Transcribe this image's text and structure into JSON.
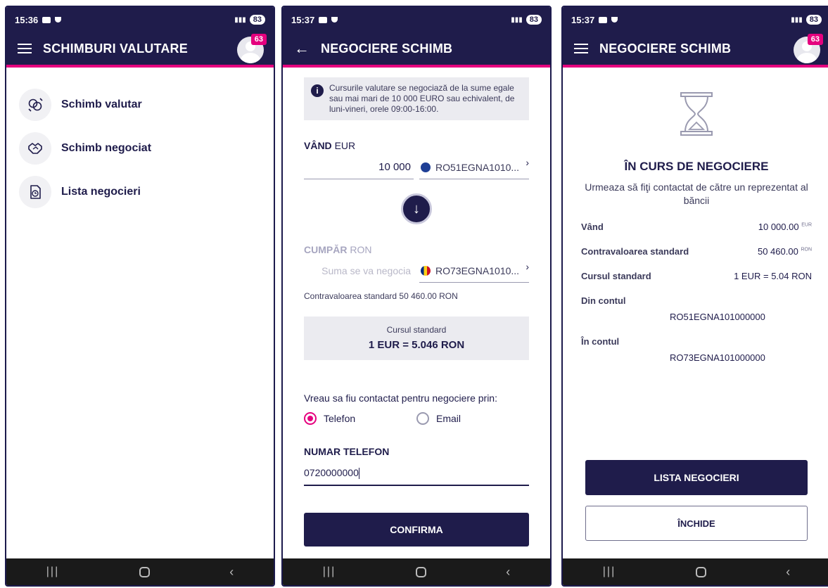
{
  "colors": {
    "primary": "#1f1c4b",
    "accent": "#e5007e",
    "panel": "#ebebf0"
  },
  "screen1": {
    "status": {
      "time": "15:36",
      "battery": "83"
    },
    "title": "SCHIMBURI VALUTARE",
    "badge": "63",
    "menu": [
      {
        "label": "Schimb valutar",
        "icon": "currency-exchange-icon"
      },
      {
        "label": "Schimb negociat",
        "icon": "handshake-icon"
      },
      {
        "label": "Lista negocieri",
        "icon": "clock-document-icon"
      }
    ]
  },
  "screen2": {
    "status": {
      "time": "15:37",
      "battery": "83"
    },
    "title": "NEGOCIERE SCHIMB",
    "info": "Cursurile valutare se negociază de la sume egale sau mai mari de 10 000 EURO sau echivalent, de luni-vineri, orele 09:00-16:00.",
    "sell": {
      "label": "VÂND",
      "currency": "EUR",
      "amount": "10 000",
      "account": "RO51EGNA1010..."
    },
    "buy": {
      "label": "CUMPĂR",
      "currency": "RON",
      "placeholder": "Suma se va negocia",
      "account": "RO73EGNA1010..."
    },
    "standard_note": "Contravaloarea standard 50 460.00 RON",
    "rate": {
      "caption": "Cursul standard",
      "value": "1 EUR = 5.046 RON"
    },
    "contact_question": "Vreau sa fiu contactat pentru negociere prin:",
    "options": {
      "phone": "Telefon",
      "email": "Email",
      "selected": "phone"
    },
    "phone_label": "NUMAR TELEFON",
    "phone_value": "0720000000",
    "confirm": "CONFIRMA"
  },
  "screen3": {
    "status": {
      "time": "15:37",
      "battery": "83"
    },
    "title": "NEGOCIERE SCHIMB",
    "badge": "63",
    "status_title": "ÎN CURS DE NEGOCIERE",
    "status_sub": "Urmeaza să fiţi contactat de către un reprezentat al băncii",
    "rows": [
      {
        "label": "Vând",
        "value": "10 000.00",
        "unit": "EUR"
      },
      {
        "label": "Contravaloarea standard",
        "value": "50 460.00",
        "unit": "RON"
      },
      {
        "label": "Cursul standard",
        "value": "1 EUR = 5.04 RON",
        "unit": ""
      }
    ],
    "from_label": "Din contul",
    "from_iban": "RO51EGNA101000000",
    "to_label": "În contul",
    "to_iban": "RO73EGNA101000000",
    "btn_list": "LISTA NEGOCIERI",
    "btn_close": "ÎNCHIDE"
  }
}
